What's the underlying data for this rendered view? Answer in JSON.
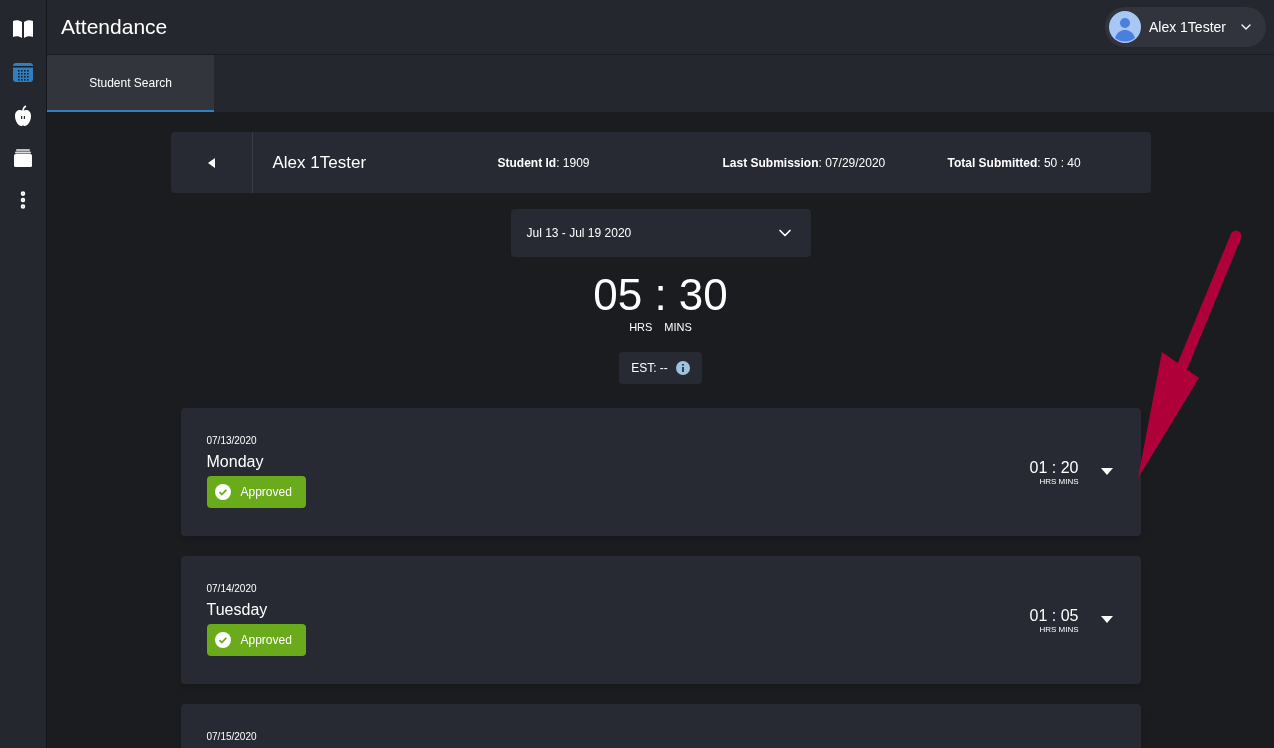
{
  "sidebar": {
    "items": [
      {
        "kind": "book",
        "selected": false
      },
      {
        "kind": "calendar",
        "selected": true
      },
      {
        "kind": "apple",
        "selected": false
      },
      {
        "kind": "stack",
        "selected": false
      },
      {
        "kind": "more",
        "selected": false
      }
    ]
  },
  "header": {
    "title": "Attendance",
    "user": {
      "name": "Alex 1Tester"
    }
  },
  "tabs": [
    {
      "label": "Student Search",
      "selected": true
    }
  ],
  "student": {
    "name": "Alex 1Tester",
    "fields": [
      "**Student Id**: 1909",
      "**Last Submission**: 07/29/2020",
      "**Total Submitted**: 50 : 40"
    ]
  },
  "week_select": {
    "value": "Jul 13 - Jul 19 2020"
  },
  "total": {
    "hours": "05",
    "minutes": "30",
    "separator": ":",
    "hours_label": "HRS",
    "minutes_label": "MINS"
  },
  "estimate": {
    "text": "EST: --"
  },
  "days": [
    {
      "date": "07/13/2020",
      "day": "Monday",
      "status": {
        "kind": "approved",
        "label": "Approved"
      },
      "time": "01 : 20",
      "time_label": "HRS MINS",
      "expanded": false
    },
    {
      "date": "07/14/2020",
      "day": "Tuesday",
      "status": {
        "kind": "approved",
        "label": "Approved"
      },
      "time": "01 : 05",
      "time_label": "HRS MINS",
      "expanded": false
    },
    {
      "date": "07/15/2020"
    }
  ],
  "annotation": {
    "kind": "arrow"
  }
}
